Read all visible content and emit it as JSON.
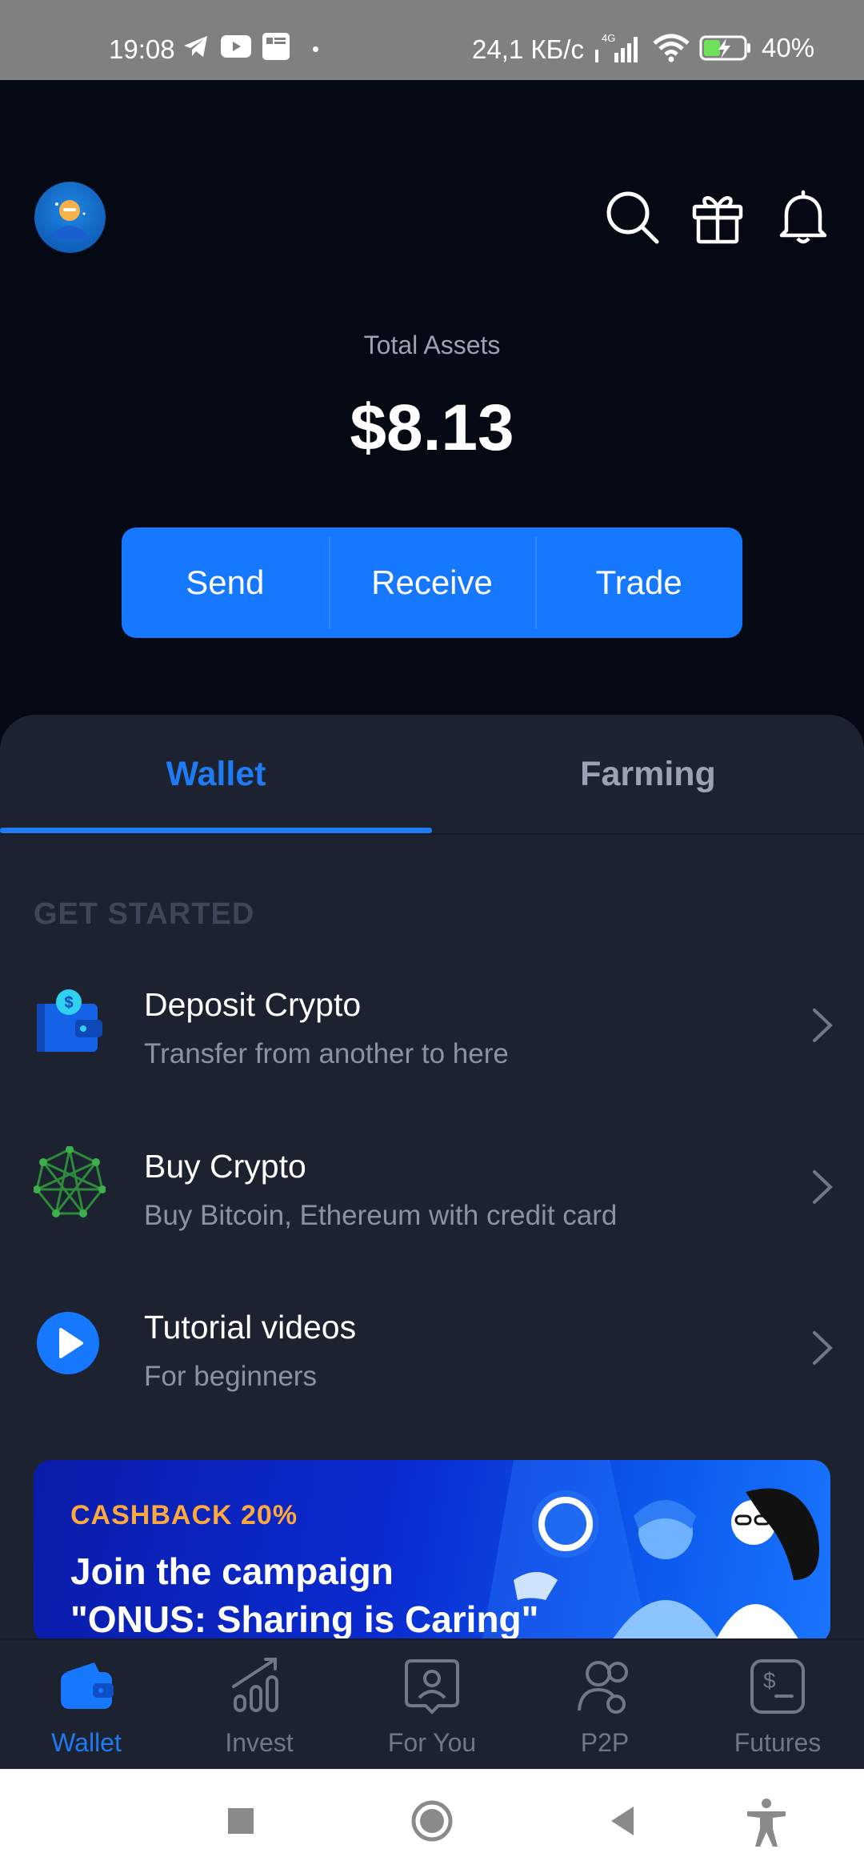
{
  "status_bar": {
    "time": "19:08",
    "net_speed": "24,1 КБ/с",
    "network": "4G",
    "battery": "40%",
    "left_icons": [
      "telegram-icon",
      "youtube-icon",
      "app-icon"
    ],
    "right_icons": [
      "signal-icon",
      "wifi-icon",
      "battery-charging-icon"
    ]
  },
  "header": {
    "icons": [
      "avatar",
      "search-icon",
      "gift-icon",
      "bell-icon"
    ]
  },
  "balance": {
    "label": "Total Assets",
    "value": "$8.13"
  },
  "actions": {
    "send": "Send",
    "receive": "Receive",
    "trade": "Trade"
  },
  "tabs": {
    "wallet": "Wallet",
    "farming": "Farming",
    "active": "Wallet"
  },
  "get_started": {
    "title": "GET STARTED",
    "items": [
      {
        "title": "Deposit Crypto",
        "subtitle": "Transfer from another to here",
        "icon": "wallet-deposit-icon"
      },
      {
        "title": "Buy Crypto",
        "subtitle": "Buy Bitcoin, Ethereum with credit card",
        "icon": "network-nodes-icon"
      },
      {
        "title": "Tutorial videos",
        "subtitle": "For beginners",
        "icon": "play-icon"
      }
    ]
  },
  "banner": {
    "tag": "CASHBACK 20%",
    "line1": "Join the campaign",
    "line2": "\"ONUS: Sharing is Caring\""
  },
  "bottom_nav": {
    "items": [
      {
        "label": "Wallet",
        "icon": "wallet-icon",
        "active": true
      },
      {
        "label": "Invest",
        "icon": "chart-icon",
        "active": false
      },
      {
        "label": "For You",
        "icon": "profile-card-icon",
        "active": false
      },
      {
        "label": "P2P",
        "icon": "users-icon",
        "active": false
      },
      {
        "label": "Futures",
        "icon": "futures-icon",
        "active": false
      }
    ]
  },
  "system_nav": [
    "recents-icon",
    "home-icon",
    "back-icon",
    "accessibility-icon"
  ],
  "colors": {
    "accent": "#1677ff",
    "background": "#050914",
    "sheet": "#1c2230",
    "muted": "#9aa3b3",
    "cashback": "#ffa83b"
  }
}
